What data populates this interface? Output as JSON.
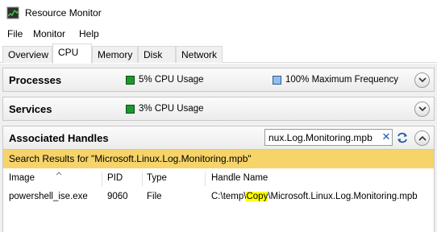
{
  "window": {
    "title": "Resource Monitor"
  },
  "menu": [
    "File",
    "Monitor",
    "Help"
  ],
  "tabs": [
    "Overview",
    "CPU",
    "Memory",
    "Disk",
    "Network"
  ],
  "active_tab": "CPU",
  "processes": {
    "title": "Processes",
    "cpu_usage": "5% CPU Usage",
    "max_frequency": "100% Maximum Frequency"
  },
  "services": {
    "title": "Services",
    "cpu_usage": "3% CPU Usage"
  },
  "handles": {
    "title": "Associated Handles",
    "search_value": "nux.Log.Monitoring.mpb",
    "results_text": "Search Results for \"Microsoft.Linux.Log.Monitoring.mpb\"",
    "columns": [
      "Image",
      "PID",
      "Type",
      "Handle Name"
    ],
    "row": {
      "image": "powershell_ise.exe",
      "pid": "9060",
      "type": "File",
      "handle_prefix": "C:\\temp\\",
      "handle_highlight": "Copy",
      "handle_suffix": "\\Microsoft.Linux.Log.Monitoring.mpb"
    }
  },
  "colors": {
    "results_bar": "#f6d46a",
    "cpu_green": "#1a9a2a",
    "frequency_blue": "#8cc0f4",
    "highlight": "#ffff00"
  },
  "icons": [
    "resource-monitor-icon",
    "chevron-down-icon",
    "chevron-up-icon",
    "clear-search-icon",
    "refresh-icon",
    "sort-ascending-icon"
  ]
}
